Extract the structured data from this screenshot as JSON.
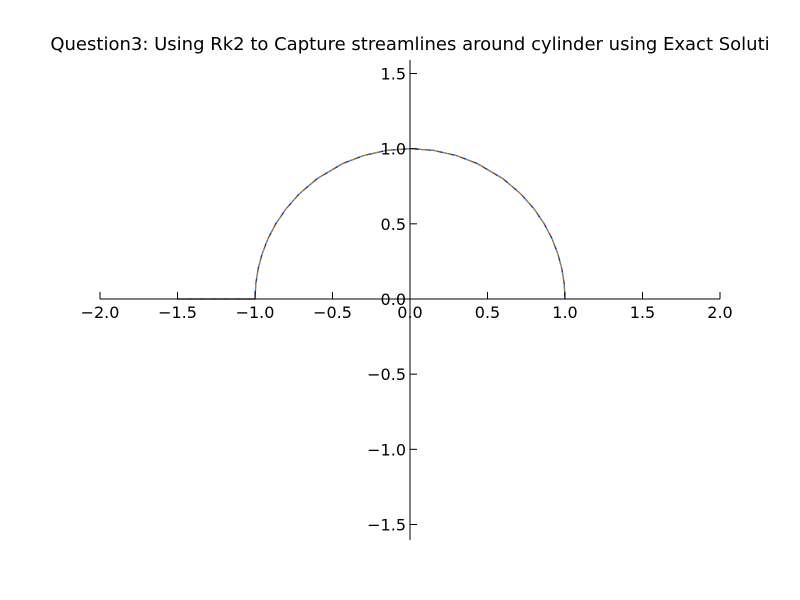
{
  "chart_data": {
    "type": "line",
    "title": "Question3: Using Rk2 to Capture streamlines around cylinder using Exact Soluti",
    "xlabel": "",
    "ylabel": "",
    "xlim": [
      -2.0,
      2.0
    ],
    "ylim": [
      -1.55,
      1.55
    ],
    "x_ticks": [
      -2.0,
      -1.5,
      -1.0,
      -0.5,
      0.0,
      0.5,
      1.0,
      1.5,
      2.0
    ],
    "x_tick_labels": [
      "−2.0",
      "−1.5",
      "−1.0",
      "−0.5",
      "0.0",
      "0.5",
      "1.0",
      "1.5",
      "2.0"
    ],
    "y_ticks": [
      -1.5,
      -1.0,
      -0.5,
      0.0,
      0.5,
      1.0,
      1.5
    ],
    "y_tick_labels": [
      "−1.5",
      "−1.0",
      "−0.5",
      "0.0",
      "0.5",
      "1.0",
      "1.5"
    ],
    "spines": "centered at origin",
    "grid": false,
    "series": [
      {
        "color": "#000000",
        "points": [
          [
            -1.5,
            0.0
          ],
          [
            -1.0,
            0.0
          ],
          [
            -0.995,
            0.1
          ],
          [
            -0.98,
            0.2
          ],
          [
            -0.954,
            0.3
          ],
          [
            -0.917,
            0.4
          ],
          [
            -0.866,
            0.5
          ],
          [
            -0.8,
            0.6
          ],
          [
            -0.714,
            0.7
          ],
          [
            -0.6,
            0.8
          ],
          [
            -0.436,
            0.9
          ],
          [
            -0.3,
            0.954
          ],
          [
            -0.15,
            0.989
          ],
          [
            0.0,
            1.0
          ],
          [
            0.15,
            0.989
          ],
          [
            0.3,
            0.954
          ],
          [
            0.436,
            0.9
          ],
          [
            0.6,
            0.8
          ],
          [
            0.714,
            0.7
          ],
          [
            0.8,
            0.6
          ],
          [
            0.866,
            0.5
          ],
          [
            0.917,
            0.4
          ],
          [
            0.954,
            0.3
          ],
          [
            0.98,
            0.2
          ],
          [
            0.995,
            0.1
          ],
          [
            1.0,
            0.0
          ]
        ]
      }
    ],
    "overlay_dash_colors": [
      "#1f1fd6",
      "#d62728",
      "#2ca02c",
      "#ff7f0e",
      "#9467bd",
      "#17becf"
    ]
  }
}
